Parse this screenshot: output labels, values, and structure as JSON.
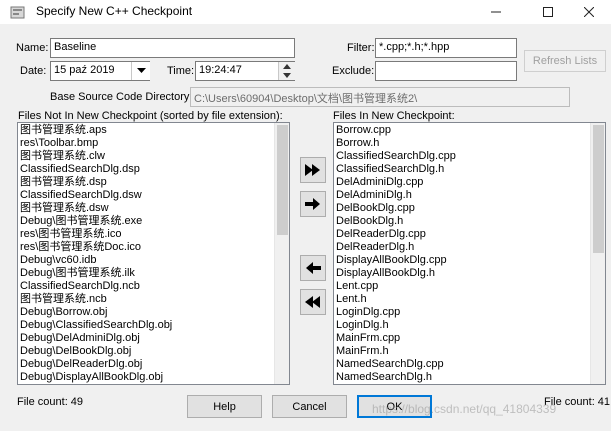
{
  "window": {
    "title": "Specify New C++ Checkpoint"
  },
  "form": {
    "name_label": "Name:",
    "name_value": "Baseline",
    "filter_label": "Filter:",
    "filter_value": "*.cpp;*.h;*.hpp",
    "date_label": "Date:",
    "date_value": "15 paź 2019",
    "time_label": "Time:",
    "time_value": "19:24:47",
    "exclude_label": "Exclude:",
    "exclude_value": "",
    "refresh_label": "Refresh Lists",
    "base_dir_label": "Base Source Code Directory:",
    "base_dir_value": "C:\\Users\\60904\\Desktop\\文档\\图书管理系统2\\"
  },
  "left_list": {
    "header": "Files Not In New Checkpoint (sorted by file extension):",
    "items": [
      "图书管理系统.aps",
      "res\\Toolbar.bmp",
      "图书管理系统.clw",
      "ClassifiedSearchDlg.dsp",
      "图书管理系统.dsp",
      "ClassifiedSearchDlg.dsw",
      "图书管理系统.dsw",
      "Debug\\图书管理系统.exe",
      "res\\图书管理系统.ico",
      "res\\图书管理系统Doc.ico",
      "Debug\\vc60.idb",
      "Debug\\图书管理系统.ilk",
      "ClassifiedSearchDlg.ncb",
      "图书管理系统.ncb",
      "Debug\\Borrow.obj",
      "Debug\\ClassifiedSearchDlg.obj",
      "Debug\\DelAdminiDlg.obj",
      "Debug\\DelBookDlg.obj",
      "Debug\\DelReaderDlg.obj",
      "Debug\\DisplayAllBookDlg.obj"
    ],
    "count": "File count: 49"
  },
  "right_list": {
    "header": "Files In New Checkpoint:",
    "items": [
      "Borrow.cpp",
      "Borrow.h",
      "ClassifiedSearchDlg.cpp",
      "ClassifiedSearchDlg.h",
      "DelAdminiDlg.cpp",
      "DelAdminiDlg.h",
      "DelBookDlg.cpp",
      "DelBookDlg.h",
      "DelReaderDlg.cpp",
      "DelReaderDlg.h",
      "DisplayAllBookDlg.cpp",
      "DisplayAllBookDlg.h",
      "Lent.cpp",
      "Lent.h",
      "LoginDlg.cpp",
      "LoginDlg.h",
      "MainFrm.cpp",
      "MainFrm.h",
      "NamedSearchDlg.cpp",
      "NamedSearchDlg.h"
    ],
    "count": "File count: 41"
  },
  "buttons": {
    "help": "Help",
    "cancel": "Cancel",
    "ok": "OK"
  },
  "watermark": "https://blog.csdn.net/qq_41804339"
}
